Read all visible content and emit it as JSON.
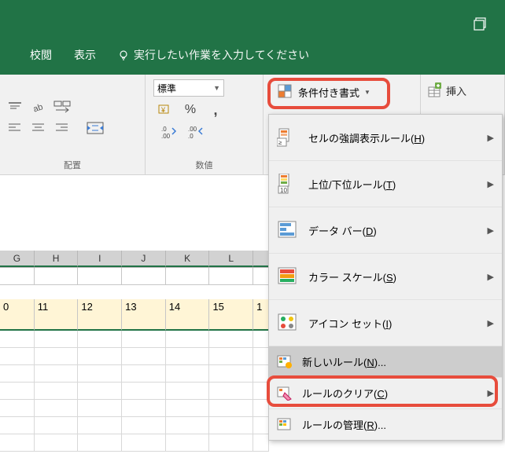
{
  "window": {
    "restore_icon": "restore"
  },
  "tabs": {
    "review": "校閲",
    "view": "表示",
    "tellme_placeholder": "実行したい作業を入力してください"
  },
  "ribbon": {
    "alignment_label": "配置",
    "number_label": "数値",
    "number_format": "標準",
    "percent": "%",
    "comma": ",",
    "decimal_inc": ".0→.00",
    "decimal_dec": ".00→.0",
    "cond_format_label": "条件付き書式",
    "insert_label": "挿入"
  },
  "menu": {
    "highlight_rules": "セルの強調表示ルール",
    "highlight_rules_key": "H",
    "top_bottom": "上位/下位ルール",
    "top_bottom_key": "T",
    "data_bars": "データ バー",
    "data_bars_key": "D",
    "color_scales": "カラー スケール",
    "color_scales_key": "S",
    "icon_sets": "アイコン セット",
    "icon_sets_key": "I",
    "new_rule": "新しいルール",
    "new_rule_key": "N",
    "new_rule_suffix": "...",
    "clear_rules": "ルールのクリア",
    "clear_rules_key": "C",
    "manage_rules": "ルールの管理",
    "manage_rules_key": "R",
    "manage_rules_suffix": "..."
  },
  "sheet": {
    "columns": [
      "G",
      "H",
      "I",
      "J",
      "K",
      "L"
    ],
    "row_values": [
      "0",
      "11",
      "12",
      "13",
      "14",
      "15",
      "1"
    ]
  }
}
